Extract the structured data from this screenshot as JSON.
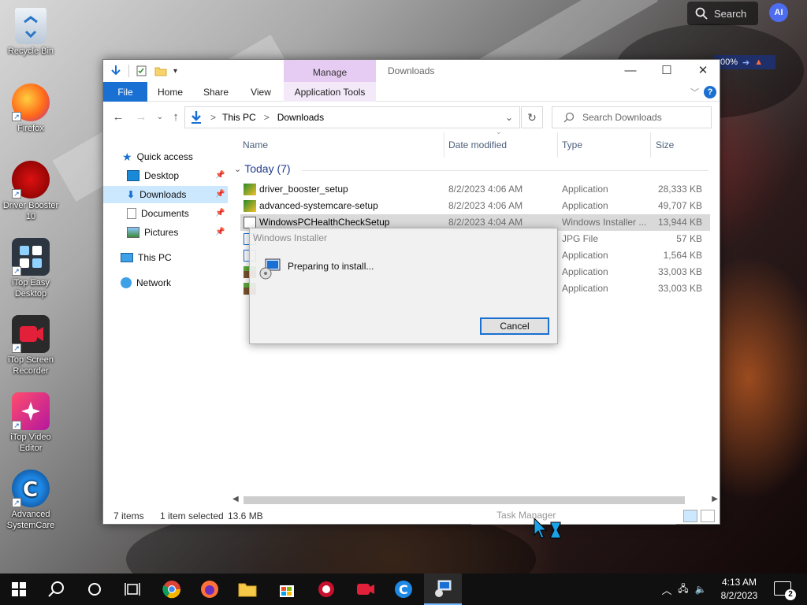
{
  "desktop": {
    "icons": [
      {
        "label": "Recycle Bin"
      },
      {
        "label": "Firefox"
      },
      {
        "label": "Driver Booster 10"
      },
      {
        "label": "iTop Easy Desktop"
      },
      {
        "label": "iTop Screen Recorder"
      },
      {
        "label": "iTop Video Editor"
      },
      {
        "label": "Advanced SystemCare"
      }
    ],
    "search_label": "Search",
    "ai_label": "AI",
    "battery_text": "00%"
  },
  "explorer": {
    "manage_tab": "Manage",
    "title": "Downloads",
    "ribbon_tabs": {
      "file": "File",
      "home": "Home",
      "share": "Share",
      "view": "View",
      "app_tools": "Application Tools"
    },
    "help_label": "?",
    "address": {
      "this_pc": "This PC",
      "separator": ">",
      "current": "Downloads"
    },
    "search_placeholder": "Search Downloads",
    "nav": {
      "quick_access": "Quick access",
      "desktop": "Desktop",
      "downloads": "Downloads",
      "documents": "Documents",
      "pictures": "Pictures",
      "this_pc": "This PC",
      "network": "Network"
    },
    "columns": {
      "name": "Name",
      "date": "Date modified",
      "type": "Type",
      "size": "Size"
    },
    "group_label": "Today (7)",
    "files": [
      {
        "name": "driver_booster_setup",
        "date": "8/2/2023 4:06 AM",
        "type": "Application",
        "size": "28,333 KB"
      },
      {
        "name": "advanced-systemcare-setup",
        "date": "8/2/2023 4:06 AM",
        "type": "Application",
        "size": "49,707 KB"
      },
      {
        "name": "WindowsPCHealthCheckSetup",
        "date": "8/2/2023 4:04 AM",
        "type": "Windows Installer ...",
        "size": "13,944 KB"
      },
      {
        "name": "",
        "date": "",
        "type": "JPG File",
        "size": "57 KB"
      },
      {
        "name": "",
        "date": "",
        "type": "Application",
        "size": "1,564 KB"
      },
      {
        "name": "",
        "date": "",
        "type": "Application",
        "size": "33,003 KB"
      },
      {
        "name": "",
        "date": "",
        "type": "Application",
        "size": "33,003 KB"
      }
    ],
    "status": {
      "count": "7 items",
      "selection": "1 item selected",
      "size": "13.6 MB"
    }
  },
  "installer": {
    "title": "Windows Installer",
    "message": "Preparing to install...",
    "cancel": "Cancel"
  },
  "taskbar": {
    "time": "4:13 AM",
    "date": "8/2/2023",
    "notifications": "2",
    "ghost_label": "Task Manager"
  },
  "colors": {
    "accent": "#1a6fd2",
    "manage_tab": "#e6ccf2",
    "selection": "#cce8ff",
    "taskbar": "#101010"
  }
}
